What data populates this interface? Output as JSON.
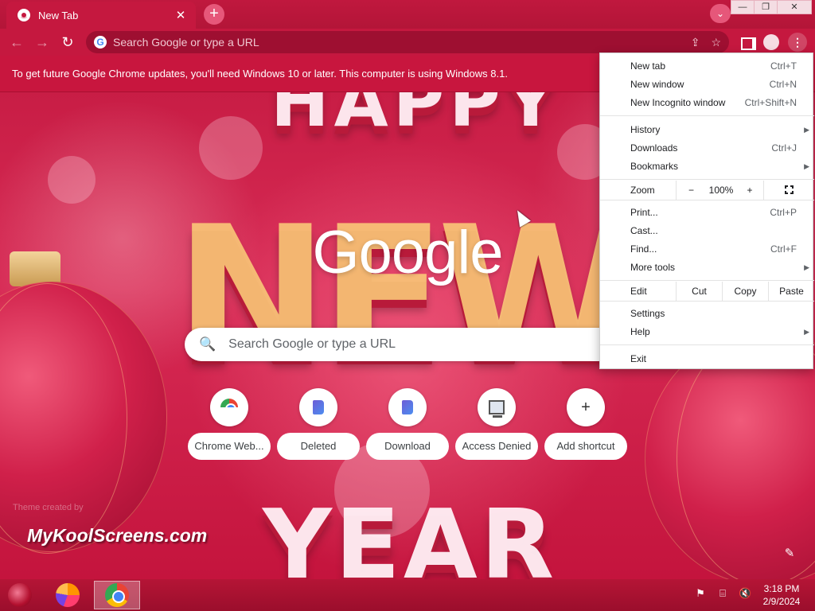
{
  "tab": {
    "title": "New Tab",
    "close_glyph": "✕"
  },
  "tabstrip": {
    "new_tab_glyph": "+",
    "tab_search_glyph": "⌄"
  },
  "window_controls": {
    "minimize": "—",
    "restore": "❐",
    "close": "✕"
  },
  "toolbar": {
    "back_glyph": "←",
    "forward_glyph": "→",
    "reload_glyph": "↻",
    "omnibox_placeholder": "Search Google or type a URL",
    "share_glyph": "⇪",
    "star_glyph": "☆",
    "menu_glyph": "⋮"
  },
  "infobar": {
    "message": "To get future Google Chrome updates, you'll need Windows 10 or later. This computer is using Windows 8.1."
  },
  "ntp": {
    "logo": "Google",
    "search_placeholder": "Search Google or type a URL",
    "search_glyph": "🔍",
    "shortcuts": [
      {
        "label": "Chrome Web...",
        "icon": "chrome-web-store-icon"
      },
      {
        "label": "Deleted",
        "icon": "bookmark-icon"
      },
      {
        "label": "Download",
        "icon": "bookmark-icon"
      },
      {
        "label": "Access Denied",
        "icon": "computer-icon"
      },
      {
        "label": "Add shortcut",
        "icon": "plus-icon",
        "glyph": "+"
      }
    ],
    "theme_credit": "Theme created by",
    "watermark": "MyKoolScreens.com",
    "customize_glyph": "✎",
    "background_letters": [
      "HAPPY",
      "NEW",
      "YEAR"
    ]
  },
  "menu": {
    "new_tab": {
      "label": "New tab",
      "shortcut": "Ctrl+T"
    },
    "new_window": {
      "label": "New window",
      "shortcut": "Ctrl+N"
    },
    "new_incognito": {
      "label": "New Incognito window",
      "shortcut": "Ctrl+Shift+N"
    },
    "history": {
      "label": "History"
    },
    "downloads": {
      "label": "Downloads",
      "shortcut": "Ctrl+J"
    },
    "bookmarks": {
      "label": "Bookmarks"
    },
    "zoom": {
      "label": "Zoom",
      "minus": "−",
      "value": "100%",
      "plus": "+"
    },
    "print": {
      "label": "Print...",
      "shortcut": "Ctrl+P"
    },
    "cast": {
      "label": "Cast..."
    },
    "find": {
      "label": "Find...",
      "shortcut": "Ctrl+F"
    },
    "more_tools": {
      "label": "More tools"
    },
    "edit": {
      "label": "Edit",
      "cut": "Cut",
      "copy": "Copy",
      "paste": "Paste"
    },
    "settings": {
      "label": "Settings"
    },
    "help": {
      "label": "Help"
    },
    "exit": {
      "label": "Exit"
    },
    "submenu_arrow": "▶"
  },
  "taskbar": {
    "tray": {
      "flag_glyph": "⚑",
      "network_glyph": "⌸",
      "volume_glyph": "🔇"
    },
    "time": "3:18 PM",
    "date": "2/9/2024"
  },
  "colors": {
    "theme_red": "#c5183f",
    "omnibox_dark": "#9e0f31",
    "accent_blue": "#4285f4"
  }
}
